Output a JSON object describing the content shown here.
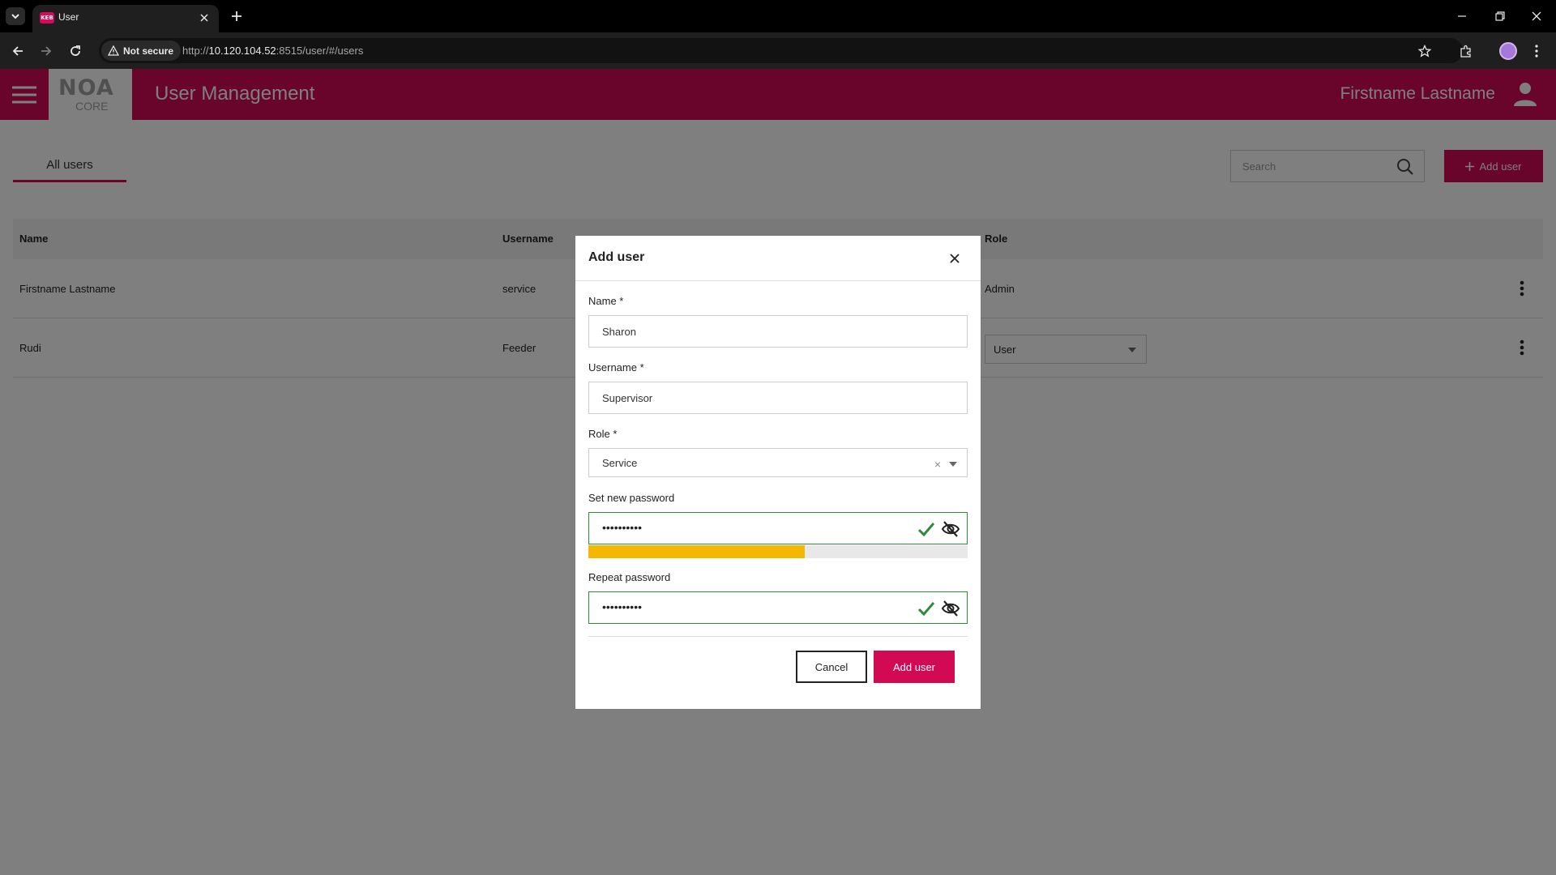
{
  "browser": {
    "tab_title": "User",
    "favicon_text": "KEB",
    "security_label": "Not secure",
    "url_scheme": "http://",
    "url_host": "10.120.104.52",
    "url_rest": ":8515/user/#/users"
  },
  "header": {
    "logo_text": "NOA",
    "logo_sub": "CORE",
    "title": "User Management",
    "user_name": "Firstname Lastname"
  },
  "tabs": {
    "all_users": "All users"
  },
  "search": {
    "placeholder": "Search"
  },
  "actions": {
    "add_user": "Add user"
  },
  "table": {
    "columns": {
      "name": "Name",
      "username": "Username",
      "role": "Role"
    },
    "rows": [
      {
        "name": "Firstname Lastname",
        "username": "service",
        "role": "Admin"
      },
      {
        "name": "Rudi",
        "username": "Feeder",
        "role": "User"
      }
    ]
  },
  "modal": {
    "title": "Add user",
    "name_label": "Name *",
    "name_value": "Sharon",
    "username_label": "Username *",
    "username_value": "Supervisor",
    "role_label": "Role *",
    "role_value": "Service",
    "role_clear": "×",
    "password_label": "Set new password",
    "password_value": "••••••••••",
    "password_strength": 0.57,
    "repeat_label": "Repeat password",
    "repeat_value": "••••••••••",
    "cancel_label": "Cancel",
    "submit_label": "Add user"
  },
  "colors": {
    "brand": "#d20a54",
    "valid": "#2e8b3a",
    "strength": "#f5b800"
  }
}
